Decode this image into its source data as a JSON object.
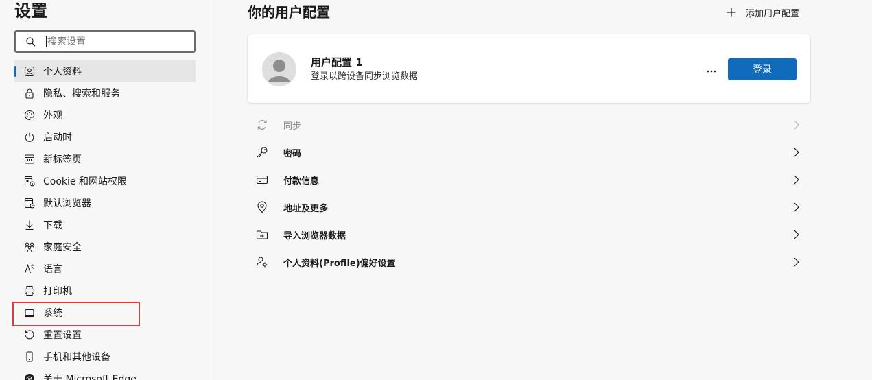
{
  "sidebar": {
    "title": "设置",
    "search": {
      "placeholder": "搜索设置",
      "value": ""
    },
    "items": [
      {
        "label": "个人资料",
        "icon": "profile-icon",
        "active": true
      },
      {
        "label": "隐私、搜索和服务",
        "icon": "lock-icon"
      },
      {
        "label": "外观",
        "icon": "palette-icon"
      },
      {
        "label": "启动时",
        "icon": "power-icon"
      },
      {
        "label": "新标签页",
        "icon": "new-tab-icon"
      },
      {
        "label": "Cookie 和网站权限",
        "icon": "site-permissions-icon"
      },
      {
        "label": "默认浏览器",
        "icon": "default-browser-icon"
      },
      {
        "label": "下载",
        "icon": "download-icon"
      },
      {
        "label": "家庭安全",
        "icon": "family-icon"
      },
      {
        "label": "语言",
        "icon": "language-icon"
      },
      {
        "label": "打印机",
        "icon": "printer-icon"
      },
      {
        "label": "系统",
        "icon": "system-icon",
        "highlighted": true
      },
      {
        "label": "重置设置",
        "icon": "reset-icon"
      },
      {
        "label": "手机和其他设备",
        "icon": "phone-icon"
      },
      {
        "label": "关于 Microsoft Edge",
        "icon": "edge-icon"
      }
    ]
  },
  "main": {
    "title": "你的用户配置",
    "add_profile_label": "添加用户配置",
    "profile": {
      "name": "用户配置 1",
      "subtitle": "登录以跨设备同步浏览数据",
      "login_label": "登录"
    },
    "rows": [
      {
        "label": "同步",
        "icon": "sync-icon",
        "disabled": true
      },
      {
        "label": "密码",
        "icon": "key-icon"
      },
      {
        "label": "付款信息",
        "icon": "card-icon"
      },
      {
        "label": "地址及更多",
        "icon": "location-icon"
      },
      {
        "label": "导入浏览器数据",
        "icon": "import-icon"
      },
      {
        "label": "个人资料(Profile)偏好设置",
        "icon": "profile-settings-icon"
      }
    ]
  },
  "colors": {
    "accent": "#0f6cbd",
    "highlight_border": "#e0393e",
    "background": "#f7f7f7"
  }
}
